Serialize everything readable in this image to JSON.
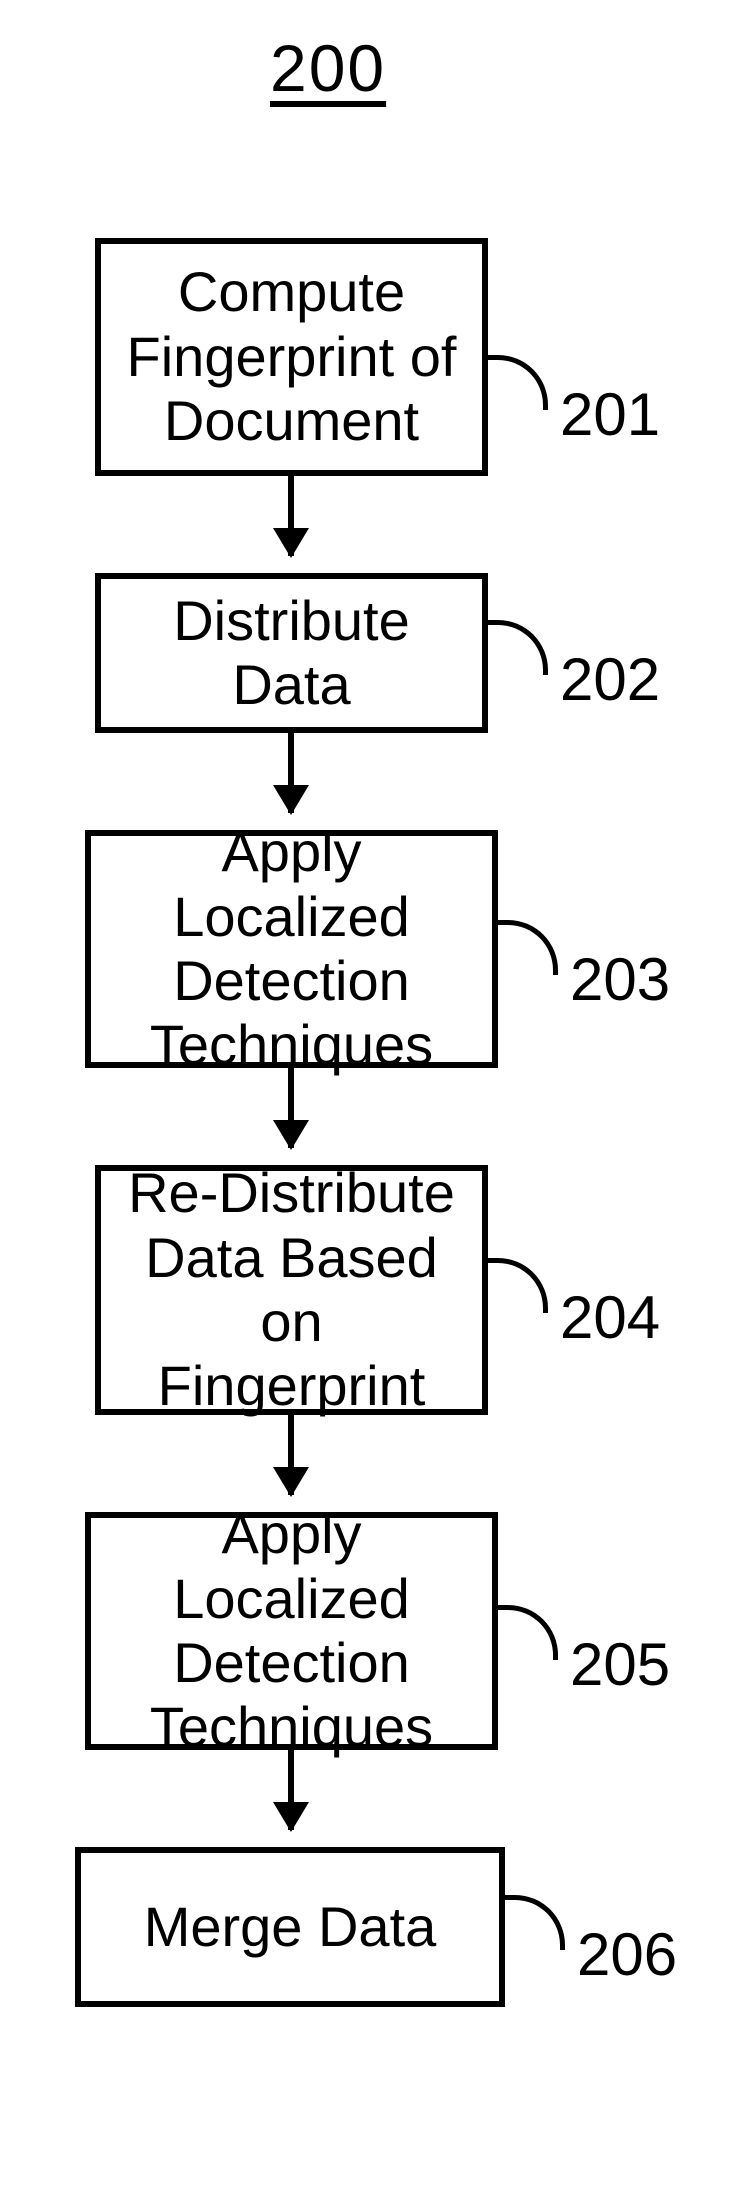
{
  "title": "200",
  "steps": [
    {
      "num": "201",
      "text": "Compute Fingerprint of Document"
    },
    {
      "num": "202",
      "text": "Distribute Data"
    },
    {
      "num": "203",
      "text": "Apply Localized Detection Techniques"
    },
    {
      "num": "204",
      "text": "Re-Distribute Data Based on Fingerprint"
    },
    {
      "num": "205",
      "text": "Apply Localized Detection Techniques"
    },
    {
      "num": "206",
      "text": "Merge Data"
    }
  ]
}
